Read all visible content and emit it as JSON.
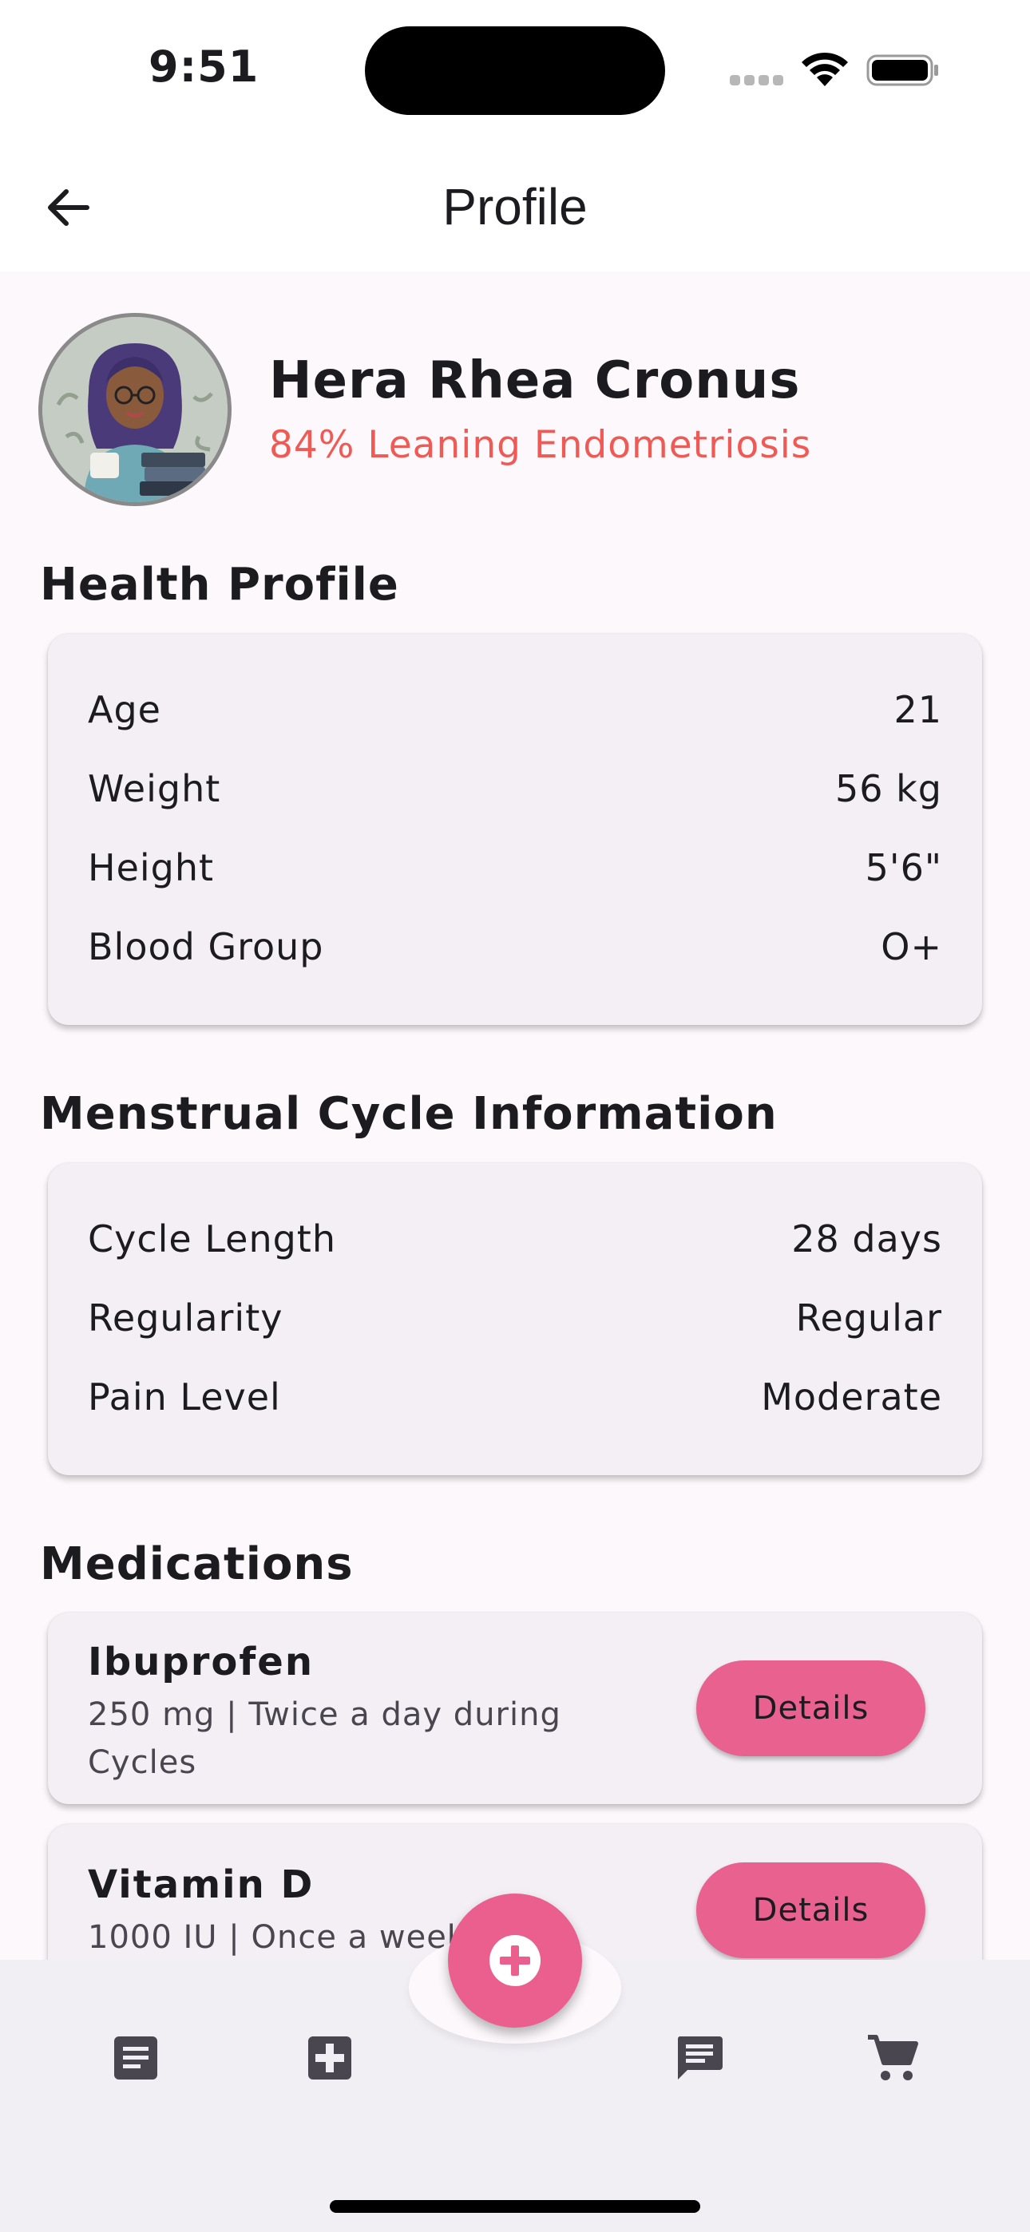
{
  "status_bar": {
    "time": "9:51"
  },
  "app_bar": {
    "title": "Profile",
    "back_icon": "arrow-left-icon"
  },
  "profile": {
    "name": "Hera Rhea Cronus",
    "status": "84% Leaning Endometriosis"
  },
  "health_profile": {
    "title": "Health Profile",
    "rows": [
      {
        "label": "Age",
        "value": "21"
      },
      {
        "label": "Weight",
        "value": "56 kg"
      },
      {
        "label": "Height",
        "value": "5'6\""
      },
      {
        "label": "Blood Group",
        "value": "O+"
      }
    ]
  },
  "cycle_info": {
    "title": "Menstrual Cycle Information",
    "rows": [
      {
        "label": "Cycle Length",
        "value": "28 days"
      },
      {
        "label": "Regularity",
        "value": "Regular"
      },
      {
        "label": "Pain Level",
        "value": "Moderate"
      }
    ]
  },
  "medications": {
    "title": "Medications",
    "items": [
      {
        "name": "Ibuprofen",
        "desc": "250 mg | Twice a day during Cycles",
        "button": "Details"
      },
      {
        "name": "Vitamin D",
        "desc": "1000 IU | Once a week",
        "button": "Details"
      }
    ]
  },
  "bottom_nav": {
    "items": [
      "article-icon",
      "medical-plus-icon",
      "chat-icon",
      "cart-icon"
    ],
    "fab_icon": "add-circle-icon"
  },
  "colors": {
    "accent": "#e8618f",
    "status_text": "#ef5a55",
    "card_bg": "#f3eff5"
  }
}
